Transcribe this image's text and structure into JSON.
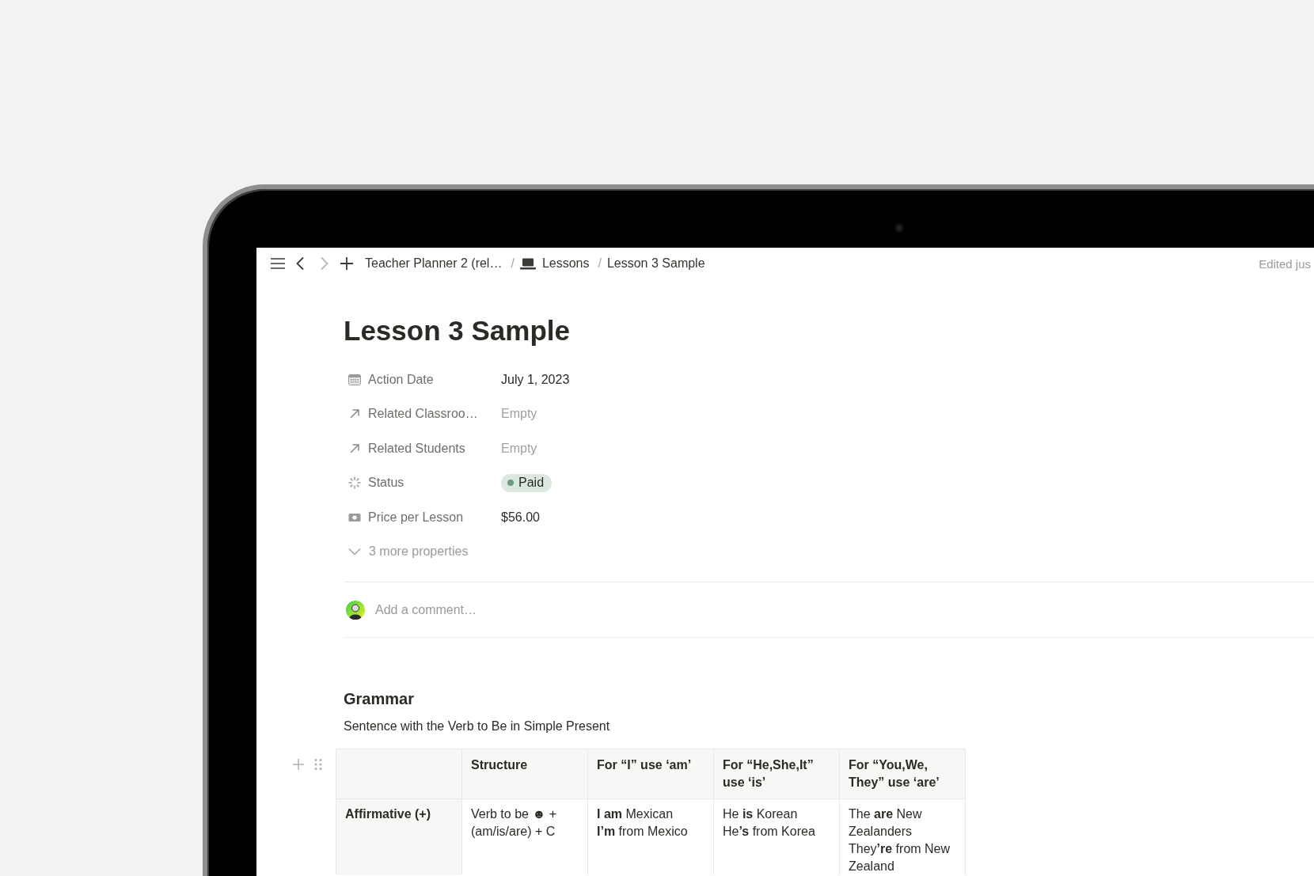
{
  "topbar": {
    "nav_buttons": [
      {
        "kind": "menu",
        "disabled": false
      },
      {
        "kind": "back",
        "disabled": false
      },
      {
        "kind": "forward",
        "disabled": true
      },
      {
        "kind": "add",
        "disabled": false
      }
    ],
    "breadcrumbs": [
      {
        "kind": "page",
        "label": "Teacher Planner 2 (rel…",
        "has_icon": false
      },
      {
        "kind": "separator",
        "label": "/"
      },
      {
        "kind": "page",
        "label": "Lessons",
        "has_icon": true
      },
      {
        "kind": "separator",
        "label": "/"
      },
      {
        "kind": "page",
        "label": "Lesson 3 Sample",
        "has_icon": false
      }
    ],
    "edited": "Edited jus"
  },
  "page": {
    "title": "Lesson 3 Sample",
    "properties": [
      {
        "kind": "date",
        "label": "Action Date",
        "value": "July 1, 2023",
        "empty": false
      },
      {
        "kind": "relation",
        "label": "Related Classroo…",
        "value": "Empty",
        "empty": true
      },
      {
        "kind": "relation",
        "label": "Related Students",
        "value": "Empty",
        "empty": true
      },
      {
        "kind": "status",
        "label": "Status",
        "value": "Paid",
        "color": "#6c9b7d",
        "empty": false
      },
      {
        "kind": "number",
        "label": "Price per Lesson",
        "value": "$56.00",
        "empty": false
      }
    ],
    "more_properties": "3 more properties",
    "comment": {
      "placeholder": "Add a comment…"
    },
    "heading": "Grammar",
    "intro": "Sentence with the Verb to Be in Simple Present",
    "table": {
      "columns": [
        "Structure",
        "For “I” use ‘am’",
        "For “He,She,It” use ‘is’",
        "For “You,We, They” use ‘are’"
      ],
      "rows": [
        {
          "label": "Affirmative (+)",
          "cells": [
            [
              "Verb to be ☻ +",
              "(am/is/are) + C"
            ],
            [
              "**I am** Mexican",
              "**I’m** from Mexico"
            ],
            [
              "He **is** Korean",
              "He**’s** from Korea"
            ],
            [
              "The **are** New Zealanders",
              "They**’re** from New Zealand"
            ]
          ]
        }
      ]
    }
  }
}
